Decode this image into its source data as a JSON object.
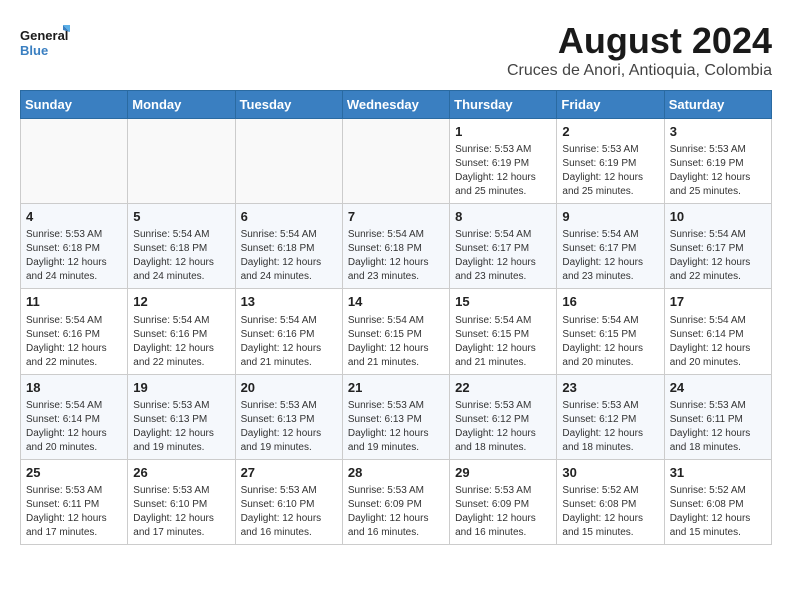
{
  "logo": {
    "line1": "General",
    "line2": "Blue"
  },
  "title": "August 2024",
  "subtitle": "Cruces de Anori, Antioquia, Colombia",
  "headers": [
    "Sunday",
    "Monday",
    "Tuesday",
    "Wednesday",
    "Thursday",
    "Friday",
    "Saturday"
  ],
  "weeks": [
    [
      {
        "day": "",
        "content": ""
      },
      {
        "day": "",
        "content": ""
      },
      {
        "day": "",
        "content": ""
      },
      {
        "day": "",
        "content": ""
      },
      {
        "day": "1",
        "content": "Sunrise: 5:53 AM\nSunset: 6:19 PM\nDaylight: 12 hours\nand 25 minutes."
      },
      {
        "day": "2",
        "content": "Sunrise: 5:53 AM\nSunset: 6:19 PM\nDaylight: 12 hours\nand 25 minutes."
      },
      {
        "day": "3",
        "content": "Sunrise: 5:53 AM\nSunset: 6:19 PM\nDaylight: 12 hours\nand 25 minutes."
      }
    ],
    [
      {
        "day": "4",
        "content": "Sunrise: 5:53 AM\nSunset: 6:18 PM\nDaylight: 12 hours\nand 24 minutes."
      },
      {
        "day": "5",
        "content": "Sunrise: 5:54 AM\nSunset: 6:18 PM\nDaylight: 12 hours\nand 24 minutes."
      },
      {
        "day": "6",
        "content": "Sunrise: 5:54 AM\nSunset: 6:18 PM\nDaylight: 12 hours\nand 24 minutes."
      },
      {
        "day": "7",
        "content": "Sunrise: 5:54 AM\nSunset: 6:18 PM\nDaylight: 12 hours\nand 23 minutes."
      },
      {
        "day": "8",
        "content": "Sunrise: 5:54 AM\nSunset: 6:17 PM\nDaylight: 12 hours\nand 23 minutes."
      },
      {
        "day": "9",
        "content": "Sunrise: 5:54 AM\nSunset: 6:17 PM\nDaylight: 12 hours\nand 23 minutes."
      },
      {
        "day": "10",
        "content": "Sunrise: 5:54 AM\nSunset: 6:17 PM\nDaylight: 12 hours\nand 22 minutes."
      }
    ],
    [
      {
        "day": "11",
        "content": "Sunrise: 5:54 AM\nSunset: 6:16 PM\nDaylight: 12 hours\nand 22 minutes."
      },
      {
        "day": "12",
        "content": "Sunrise: 5:54 AM\nSunset: 6:16 PM\nDaylight: 12 hours\nand 22 minutes."
      },
      {
        "day": "13",
        "content": "Sunrise: 5:54 AM\nSunset: 6:16 PM\nDaylight: 12 hours\nand 21 minutes."
      },
      {
        "day": "14",
        "content": "Sunrise: 5:54 AM\nSunset: 6:15 PM\nDaylight: 12 hours\nand 21 minutes."
      },
      {
        "day": "15",
        "content": "Sunrise: 5:54 AM\nSunset: 6:15 PM\nDaylight: 12 hours\nand 21 minutes."
      },
      {
        "day": "16",
        "content": "Sunrise: 5:54 AM\nSunset: 6:15 PM\nDaylight: 12 hours\nand 20 minutes."
      },
      {
        "day": "17",
        "content": "Sunrise: 5:54 AM\nSunset: 6:14 PM\nDaylight: 12 hours\nand 20 minutes."
      }
    ],
    [
      {
        "day": "18",
        "content": "Sunrise: 5:54 AM\nSunset: 6:14 PM\nDaylight: 12 hours\nand 20 minutes."
      },
      {
        "day": "19",
        "content": "Sunrise: 5:53 AM\nSunset: 6:13 PM\nDaylight: 12 hours\nand 19 minutes."
      },
      {
        "day": "20",
        "content": "Sunrise: 5:53 AM\nSunset: 6:13 PM\nDaylight: 12 hours\nand 19 minutes."
      },
      {
        "day": "21",
        "content": "Sunrise: 5:53 AM\nSunset: 6:13 PM\nDaylight: 12 hours\nand 19 minutes."
      },
      {
        "day": "22",
        "content": "Sunrise: 5:53 AM\nSunset: 6:12 PM\nDaylight: 12 hours\nand 18 minutes."
      },
      {
        "day": "23",
        "content": "Sunrise: 5:53 AM\nSunset: 6:12 PM\nDaylight: 12 hours\nand 18 minutes."
      },
      {
        "day": "24",
        "content": "Sunrise: 5:53 AM\nSunset: 6:11 PM\nDaylight: 12 hours\nand 18 minutes."
      }
    ],
    [
      {
        "day": "25",
        "content": "Sunrise: 5:53 AM\nSunset: 6:11 PM\nDaylight: 12 hours\nand 17 minutes."
      },
      {
        "day": "26",
        "content": "Sunrise: 5:53 AM\nSunset: 6:10 PM\nDaylight: 12 hours\nand 17 minutes."
      },
      {
        "day": "27",
        "content": "Sunrise: 5:53 AM\nSunset: 6:10 PM\nDaylight: 12 hours\nand 16 minutes."
      },
      {
        "day": "28",
        "content": "Sunrise: 5:53 AM\nSunset: 6:09 PM\nDaylight: 12 hours\nand 16 minutes."
      },
      {
        "day": "29",
        "content": "Sunrise: 5:53 AM\nSunset: 6:09 PM\nDaylight: 12 hours\nand 16 minutes."
      },
      {
        "day": "30",
        "content": "Sunrise: 5:52 AM\nSunset: 6:08 PM\nDaylight: 12 hours\nand 15 minutes."
      },
      {
        "day": "31",
        "content": "Sunrise: 5:52 AM\nSunset: 6:08 PM\nDaylight: 12 hours\nand 15 minutes."
      }
    ]
  ]
}
